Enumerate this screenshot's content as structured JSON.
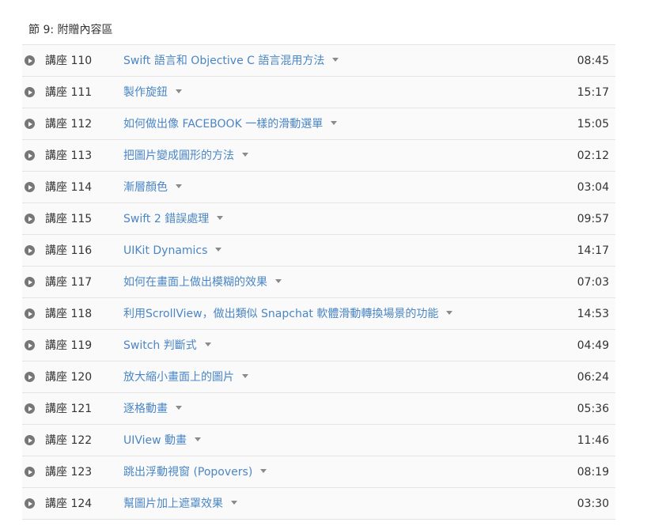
{
  "section": {
    "title": "節 9: 附贈內容區"
  },
  "lectures": [
    {
      "number": "講座 110",
      "title": "Swift 語言和 Objective C 語言混用方法",
      "duration": "08:45"
    },
    {
      "number": "講座 111",
      "title": "製作旋鈕",
      "duration": "15:17"
    },
    {
      "number": "講座 112",
      "title": "如何做出像 FACEBOOK 一樣的滑動選單",
      "duration": "15:05"
    },
    {
      "number": "講座 113",
      "title": "把圖片變成圓形的方法",
      "duration": "02:12"
    },
    {
      "number": "講座 114",
      "title": "漸層顏色",
      "duration": "03:04"
    },
    {
      "number": "講座 115",
      "title": "Swift 2 錯誤處理",
      "duration": "09:57"
    },
    {
      "number": "講座 116",
      "title": "UIKit Dynamics",
      "duration": "14:17"
    },
    {
      "number": "講座 117",
      "title": "如何在畫面上做出模糊的效果",
      "duration": "07:03"
    },
    {
      "number": "講座 118",
      "title": "利用ScrollView，做出類似 Snapchat 軟體滑動轉換場景的功能",
      "duration": "14:53"
    },
    {
      "number": "講座 119",
      "title": "Switch 判斷式",
      "duration": "04:49"
    },
    {
      "number": "講座 120",
      "title": "放大縮小畫面上的圖片",
      "duration": "06:24"
    },
    {
      "number": "講座 121",
      "title": "逐格動畫",
      "duration": "05:36"
    },
    {
      "number": "講座 122",
      "title": "UIView 動畫",
      "duration": "11:46"
    },
    {
      "number": "講座 123",
      "title": "跳出浮動視窗 (Popovers)",
      "duration": "08:19"
    },
    {
      "number": "講座 124",
      "title": "幫圖片加上遮罩效果",
      "duration": "03:30"
    }
  ],
  "icons": {
    "play": "play-circle-icon",
    "caret": "caret-down-icon"
  },
  "colors": {
    "link": "#4a86c5",
    "text": "#333333",
    "row_background": "#fafafa",
    "divider": "#e3e3e3",
    "icon": "#777777"
  }
}
